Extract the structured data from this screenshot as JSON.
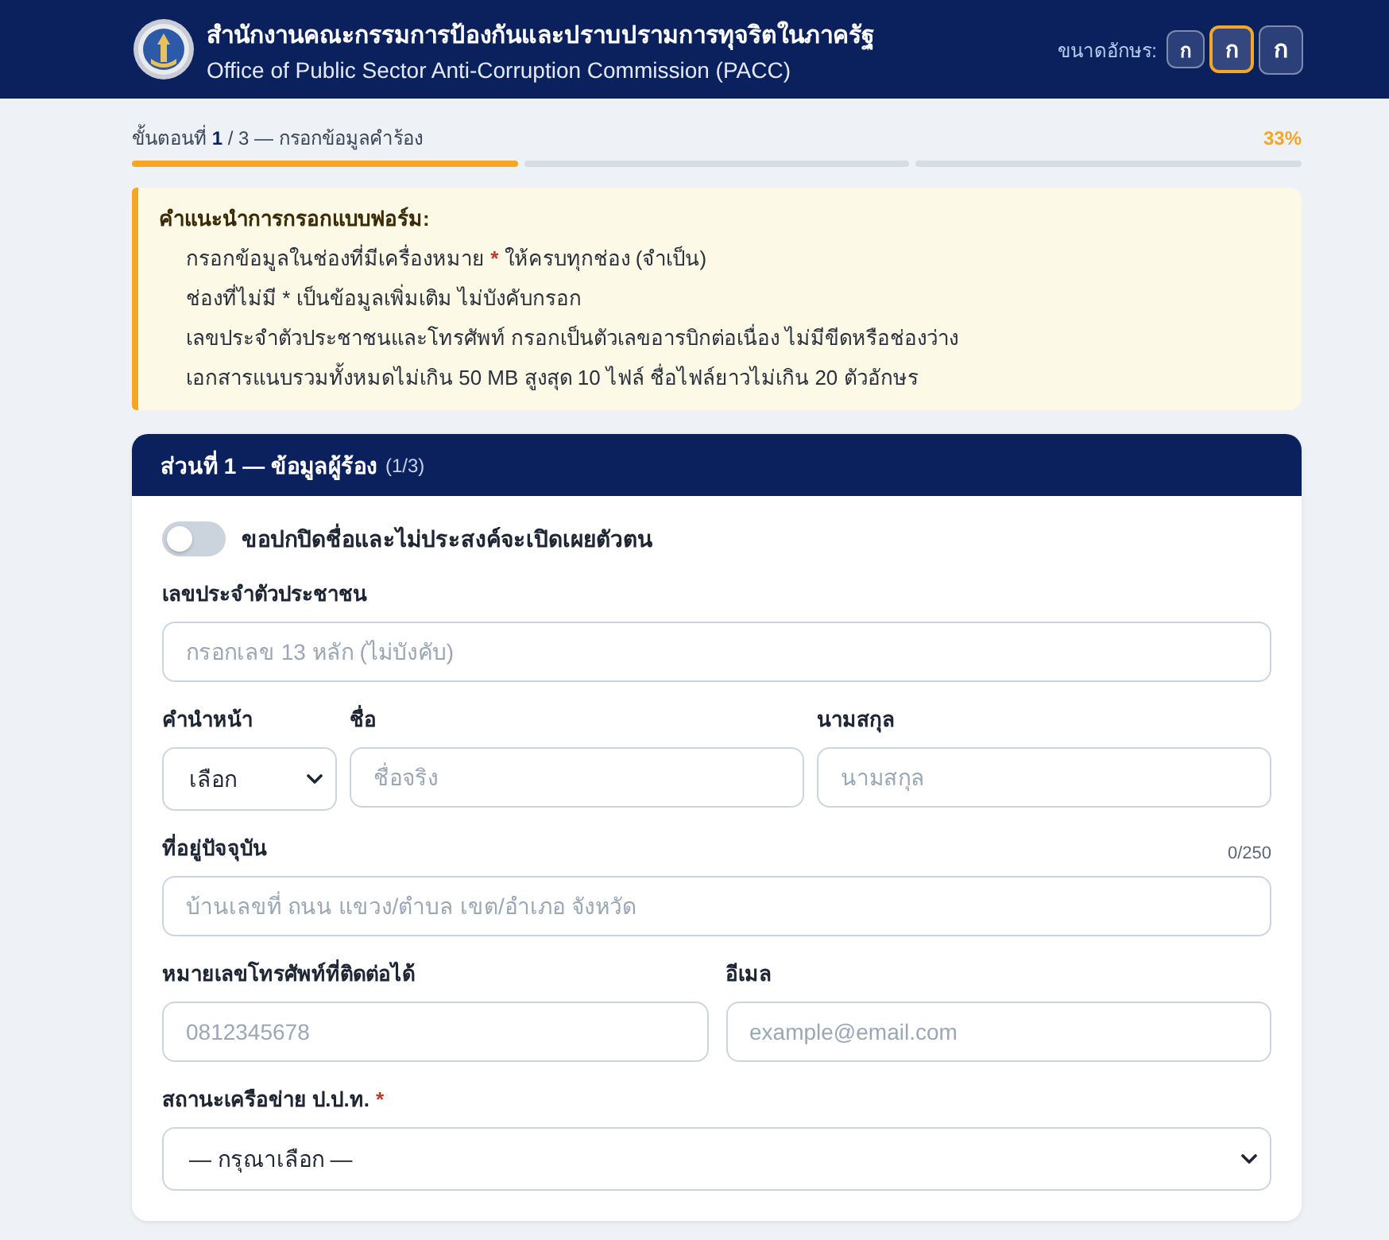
{
  "header": {
    "title_th": "สำนักงานคณะกรรมการป้องกันและปราบปรามการทุจริตในภาครัฐ",
    "title_en": "Office of Public Sector Anti-Corruption Commission (PACC)",
    "font_size": {
      "label": "ขนาดอักษร:",
      "options": [
        {
          "label": "ก",
          "kind": "small",
          "selected": false
        },
        {
          "label": "ก",
          "kind": "medium",
          "selected": true
        },
        {
          "label": "ก",
          "kind": "large",
          "selected": false
        }
      ]
    }
  },
  "progress": {
    "step_text": "ขั้นตอนที่ **1** / 3 — กรอกข้อมูลคำร้อง",
    "percent": "33%",
    "segments": [
      {
        "filled": true
      },
      {
        "filled": false
      },
      {
        "filled": false
      }
    ]
  },
  "instructions": {
    "title": "คำแนะนำการกรอกแบบฟอร์ม:",
    "items": [
      {
        "parts": [
          {
            "kind": "plain",
            "text": "กรอกข้อมูลในช่องที่มีเครื่องหมาย "
          },
          {
            "kind": "required",
            "text": "*"
          },
          {
            "kind": "plain",
            "text": " ให้ครบทุกช่อง (จำเป็น)"
          }
        ]
      },
      {
        "parts": [
          {
            "kind": "plain",
            "text": "ช่องที่ไม่มี * เป็นข้อมูลเพิ่มเติม ไม่บังคับกรอก"
          }
        ]
      },
      {
        "parts": [
          {
            "kind": "plain",
            "text": "เลขประจำตัวประชาชนและโทรศัพท์ กรอกเป็นตัวเลขอารบิกต่อเนื่อง ไม่มีขีดหรือช่องว่าง"
          }
        ]
      },
      {
        "parts": [
          {
            "kind": "plain",
            "text": "เอกสารแนบรวมทั้งหมดไม่เกิน 50 MB สูงสุด 10 ไฟล์ ชื่อไฟล์ยาวไม่เกิน 20 ตัวอักษร"
          }
        ]
      }
    ]
  },
  "section": {
    "title": "ส่วนที่ 1 — ข้อมูลผู้ร้อง",
    "count": "(1/3)",
    "anonymous_toggle": {
      "label": "ขอปกปิดชื่อและไม่ประสงค์จะเปิดเผยตัวตน",
      "on": false
    },
    "field_groups": [
      {
        "fields": [
          {
            "kind": "text",
            "label": "เลขประจำตัวประชาชน",
            "placeholder": "กรอกเลข 13 หลัก (ไม่บังคับ)"
          }
        ]
      },
      {
        "fields": [
          {
            "kind": "select",
            "label": "คำนำหน้า",
            "value": "เลือก"
          },
          {
            "kind": "text",
            "label": "ชื่อ",
            "placeholder": "ชื่อจริง"
          },
          {
            "kind": "text",
            "label": "นามสกุล",
            "placeholder": "นามสกุล"
          }
        ]
      },
      {
        "fields": [
          {
            "kind": "text",
            "label": "ที่อยู่ปัจจุบัน",
            "counter": "0/250",
            "placeholder": "บ้านเลขที่ ถนน แขวง/ตำบล เขต/อำเภอ จังหวัด"
          }
        ]
      },
      {
        "fields": [
          {
            "kind": "text",
            "label": "หมายเลขโทรศัพท์ที่ติดต่อได้",
            "placeholder": "0812345678"
          },
          {
            "kind": "text",
            "label": "อีเมล",
            "placeholder": "example@email.com"
          }
        ]
      },
      {
        "fields": [
          {
            "kind": "select",
            "label": "สถานะเครือข่าย ป.ป.ท.",
            "required_mark": "*",
            "value": "— กรุณาเลือก —"
          }
        ]
      }
    ]
  }
}
